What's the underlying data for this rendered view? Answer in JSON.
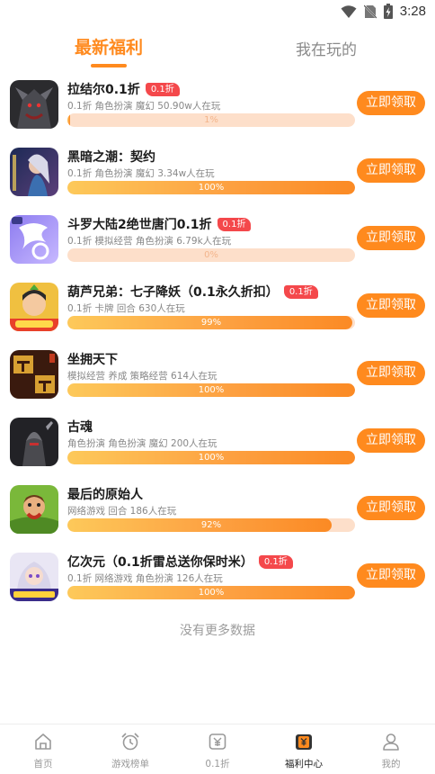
{
  "status_bar": {
    "time": "3:28",
    "icons": [
      "wifi-icon",
      "no-sim-icon",
      "battery-charging-icon"
    ]
  },
  "tabs": [
    {
      "label": "最新福利",
      "active": true
    },
    {
      "label": "我在玩的",
      "active": false
    }
  ],
  "claim_label": "立即领取",
  "games": [
    {
      "name": "拉结尔0.1折",
      "badge": "0.1折",
      "tags": "0.1折  角色扮演  魔幻   50.90w人在玩",
      "progress": 1,
      "progress_label": "1%",
      "icon": "dark-warrior-game-icon"
    },
    {
      "name": "黑暗之潮：契约",
      "badge": "",
      "tags": "0.1折  角色扮演  魔幻   3.34w人在玩",
      "progress": 100,
      "progress_label": "100%",
      "icon": "atlantis-heroine-game-icon"
    },
    {
      "name": "斗罗大陆2绝世唐门0.1折",
      "badge": "0.1折",
      "tags": "0.1折  模拟经营  角色扮演   6.79k人在玩",
      "progress": 0,
      "progress_label": "0%",
      "icon": "douluo-logo-game-icon"
    },
    {
      "name": "葫芦兄弟：七子降妖（0.1永久折扣）",
      "badge": "0.1折",
      "tags": "0.1折  卡牌  回合   630人在玩",
      "progress": 99,
      "progress_label": "99%",
      "icon": "calabash-brothers-game-icon"
    },
    {
      "name": "坐拥天下",
      "badge": "",
      "tags": "模拟经营  养成  策略经营   614人在玩",
      "progress": 100,
      "progress_label": "100%",
      "icon": "zhengtong-baye-game-icon"
    },
    {
      "name": "古魂",
      "badge": "",
      "tags": "角色扮演  角色扮演  魔幻   200人在玩",
      "progress": 100,
      "progress_label": "100%",
      "icon": "dark-knight-game-icon"
    },
    {
      "name": "最后的原始人",
      "badge": "",
      "tags": "网络游戏  回合   186人在玩",
      "progress": 92,
      "progress_label": "92%",
      "icon": "caveman-game-icon"
    },
    {
      "name": "亿次元（0.1折雷总送你保时米）",
      "badge": "0.1折",
      "tags": "0.1折  网络游戏  角色扮演   126人在玩",
      "progress": 100,
      "progress_label": "100%",
      "icon": "anime-girl-game-icon"
    }
  ],
  "footer_text": "没有更多数据",
  "bottom_nav": [
    {
      "label": "首页",
      "icon": "home-icon",
      "active": false
    },
    {
      "label": "游戏榜单",
      "icon": "alarm-clock-icon",
      "active": false
    },
    {
      "label": "0.1折",
      "icon": "yen-tag-icon",
      "active": false
    },
    {
      "label": "福利中心",
      "icon": "yen-gift-icon",
      "active": true
    },
    {
      "label": "我的",
      "icon": "user-icon",
      "active": false
    }
  ],
  "colors": {
    "accent": "#ff8a1e",
    "badge": "#f4484b",
    "progress_track": "#fddfca",
    "progress_fill": "#fb8a24",
    "muted": "#999999"
  }
}
